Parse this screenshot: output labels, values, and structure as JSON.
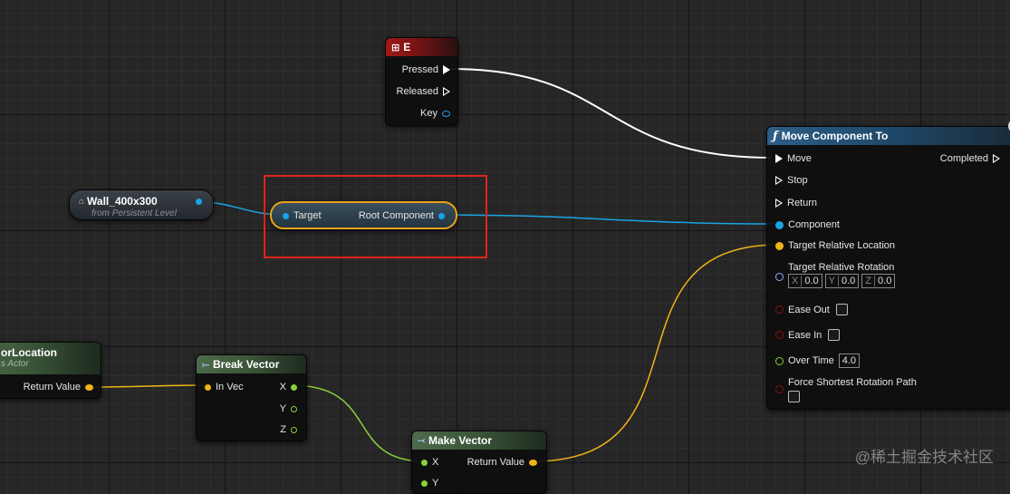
{
  "colors": {
    "exec": "#ffffff",
    "object": "#1aa3e8",
    "vector": "#f0b418",
    "rotator": "#9aa6ff",
    "bool": "#8a1010",
    "float": "#8ad03a"
  },
  "key_event_node": {
    "title": "E",
    "icon": "keyboard-icon",
    "outputs": [
      "Pressed",
      "Released",
      "Key"
    ]
  },
  "wall_node": {
    "title": "Wall_400x300",
    "subtitle": "from Persistent Level",
    "icon": "actor-icon"
  },
  "root_component_node": {
    "input": "Target",
    "output": "Root Component"
  },
  "actor_location_node": {
    "title": "orLocation",
    "subtitle": "s Actor",
    "output": "Return Value"
  },
  "break_vector_node": {
    "title": "Break Vector",
    "icon": "break-vector-icon",
    "input": "In Vec",
    "outputs": [
      "X",
      "Y",
      "Z"
    ]
  },
  "make_vector_node": {
    "title": "Make Vector",
    "icon": "make-vector-icon",
    "inputs": [
      "X",
      "Y"
    ],
    "output": "Return Value"
  },
  "move_component_node": {
    "title": "Move Component To",
    "icon": "function-icon",
    "exec_inputs": [
      "Move",
      "Stop",
      "Return"
    ],
    "exec_output": "Completed",
    "component_label": "Component",
    "target_location_label": "Target Relative Location",
    "target_rotation_label": "Target Relative Rotation",
    "rotation": {
      "x_label": "X",
      "x": "0.0",
      "y_label": "Y",
      "y": "0.0",
      "z_label": "Z",
      "z": "0.0"
    },
    "ease_out_label": "Ease Out",
    "ease_in_label": "Ease In",
    "over_time_label": "Over Time",
    "over_time": "4.0",
    "force_shortest_label": "Force Shortest Rotation Path"
  },
  "watermark": "@稀土掘金技术社区"
}
